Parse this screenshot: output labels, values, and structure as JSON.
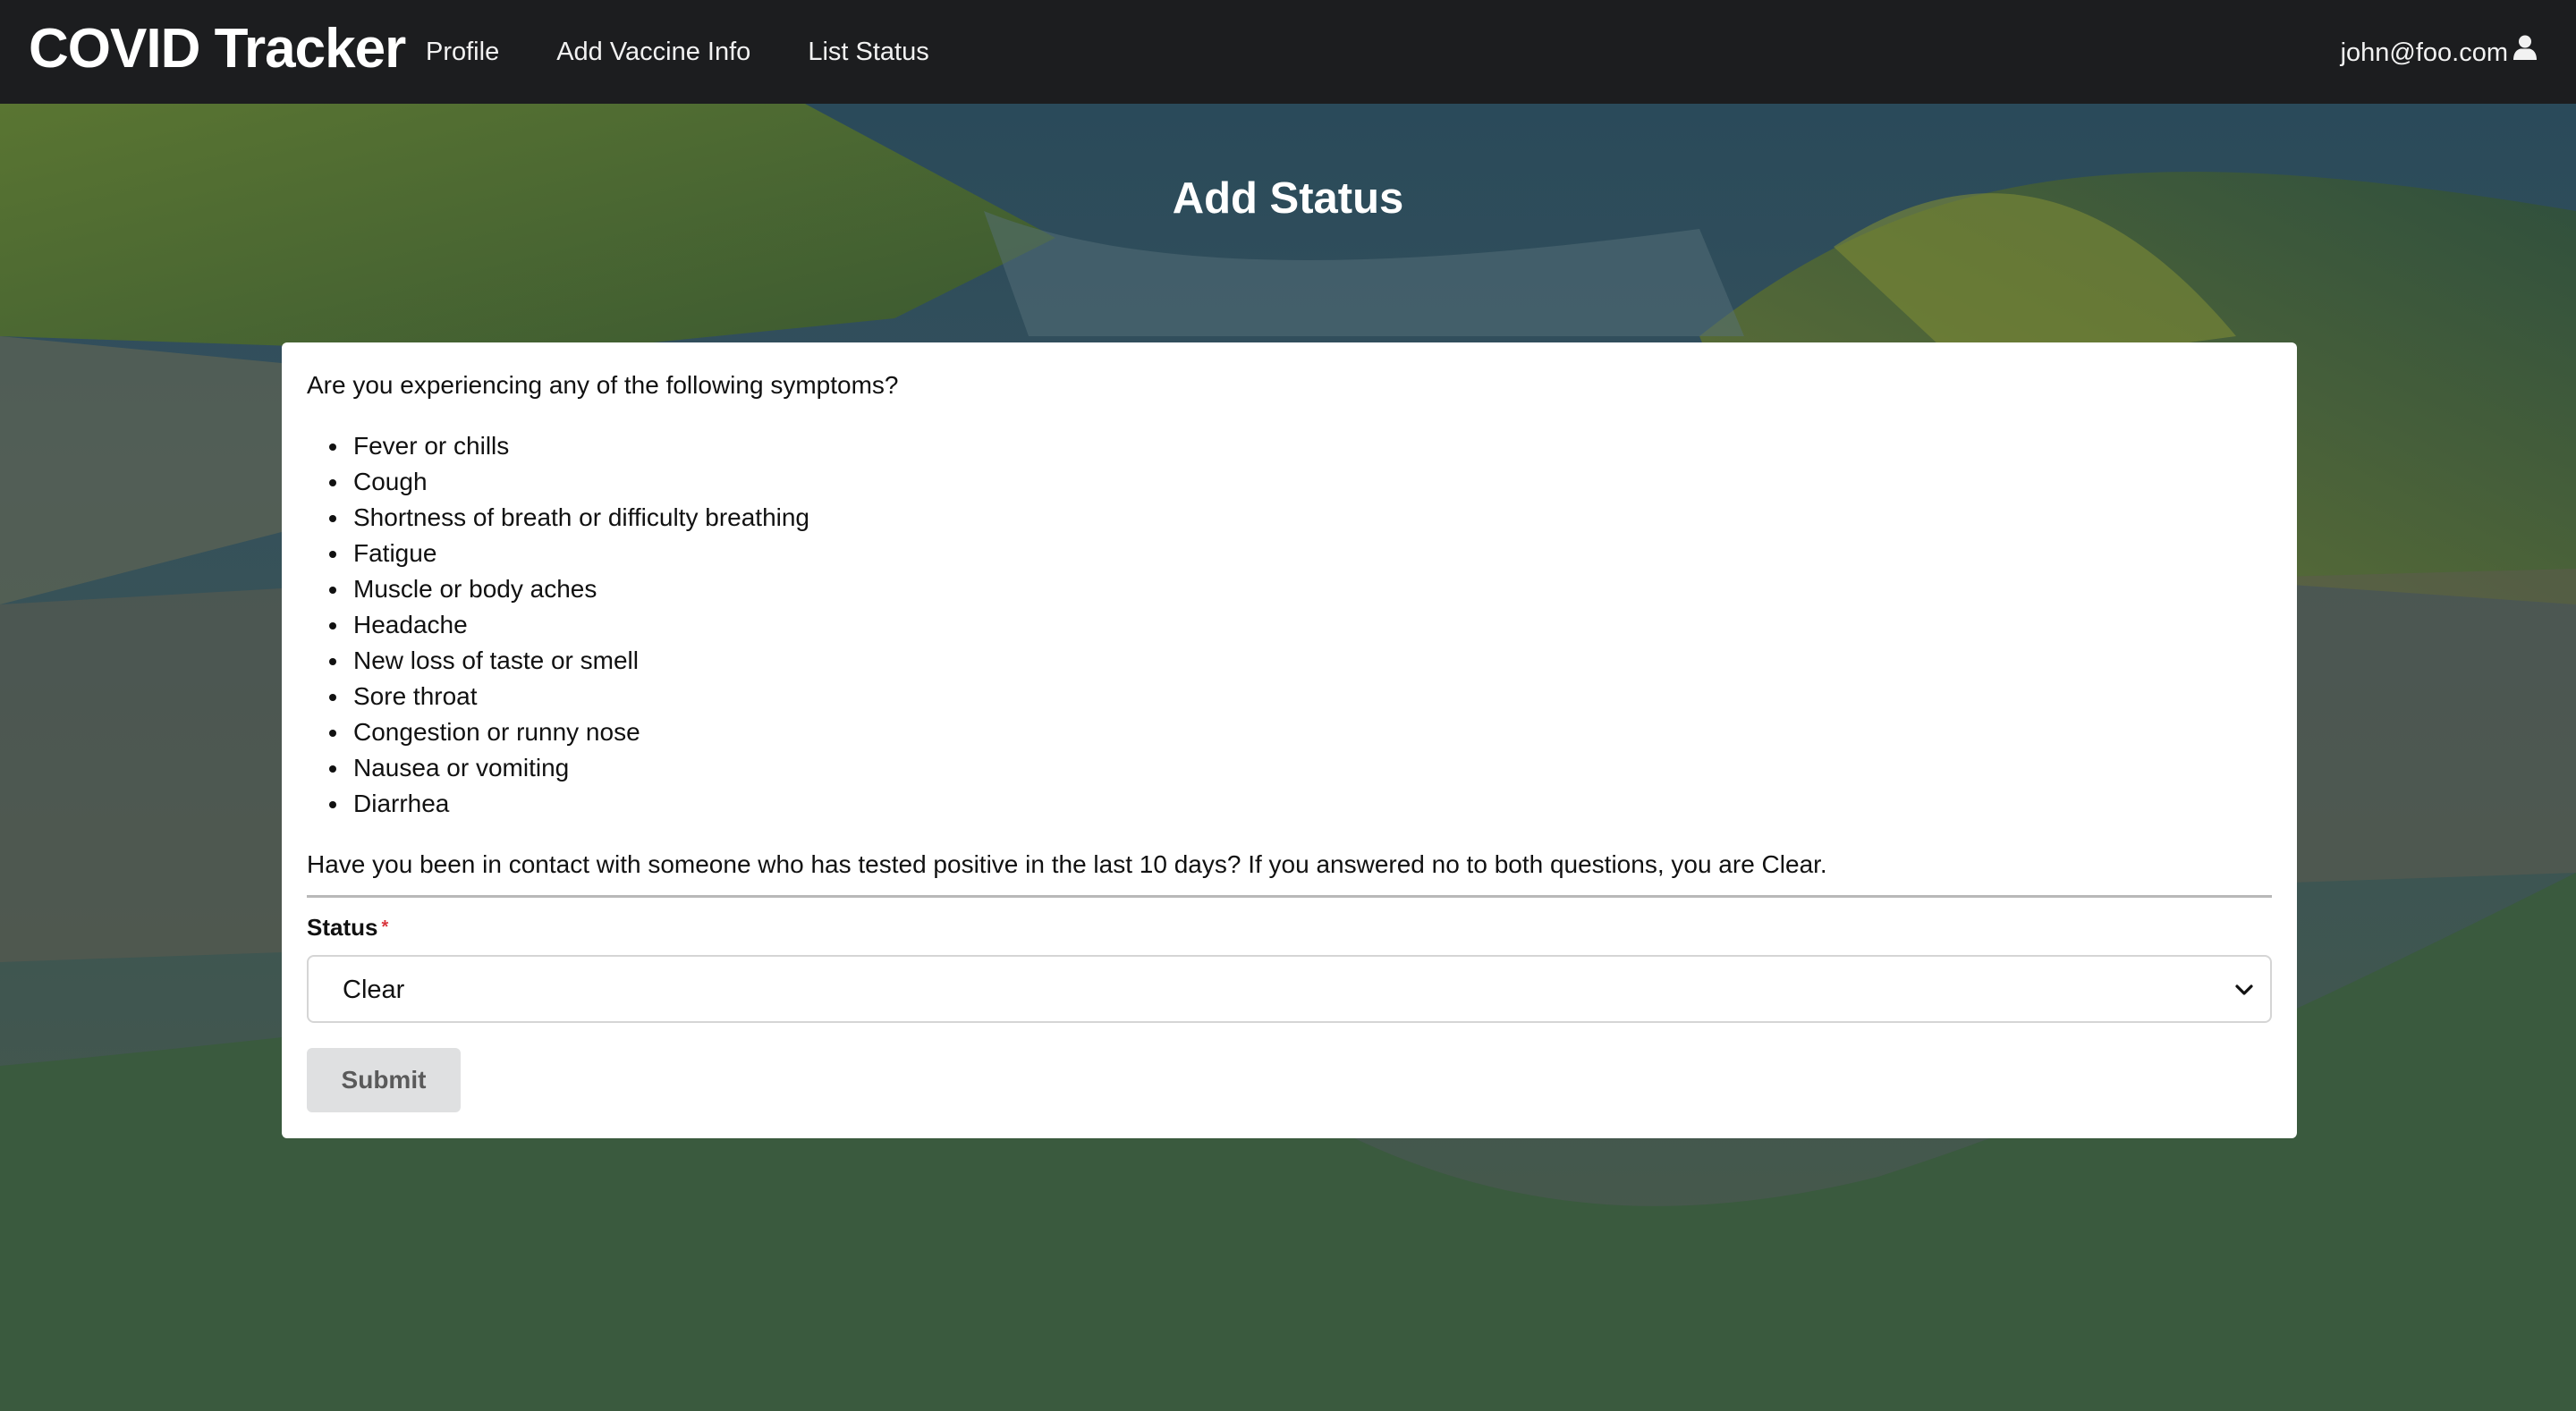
{
  "navbar": {
    "brand": "COVID Tracker",
    "links": [
      "Profile",
      "Add Vaccine Info",
      "List Status"
    ],
    "user_email": "john@foo.com",
    "user_icon": "user-icon"
  },
  "page": {
    "title": "Add Status"
  },
  "form": {
    "question_symptoms": "Are you experiencing any of the following symptoms?",
    "symptoms": [
      "Fever or chills",
      "Cough",
      "Shortness of breath or difficulty breathing",
      "Fatigue",
      "Muscle or body aches",
      "Headache",
      "New loss of taste or smell",
      "Sore throat",
      "Congestion or runny nose",
      "Nausea or vomiting",
      "Diarrhea"
    ],
    "question_contact": "Have you been in contact with someone who has tested positive in the last 10 days? If you answered no to both questions, you are Clear.",
    "status_label": "Status",
    "required_mark": "*",
    "status_value": "Clear",
    "submit_label": "Submit"
  },
  "colors": {
    "navbar_bg": "#1c1d1f",
    "page_bg_green": "#3a5a3e",
    "required": "#d9363e",
    "submit_bg": "#dfe0e1"
  }
}
